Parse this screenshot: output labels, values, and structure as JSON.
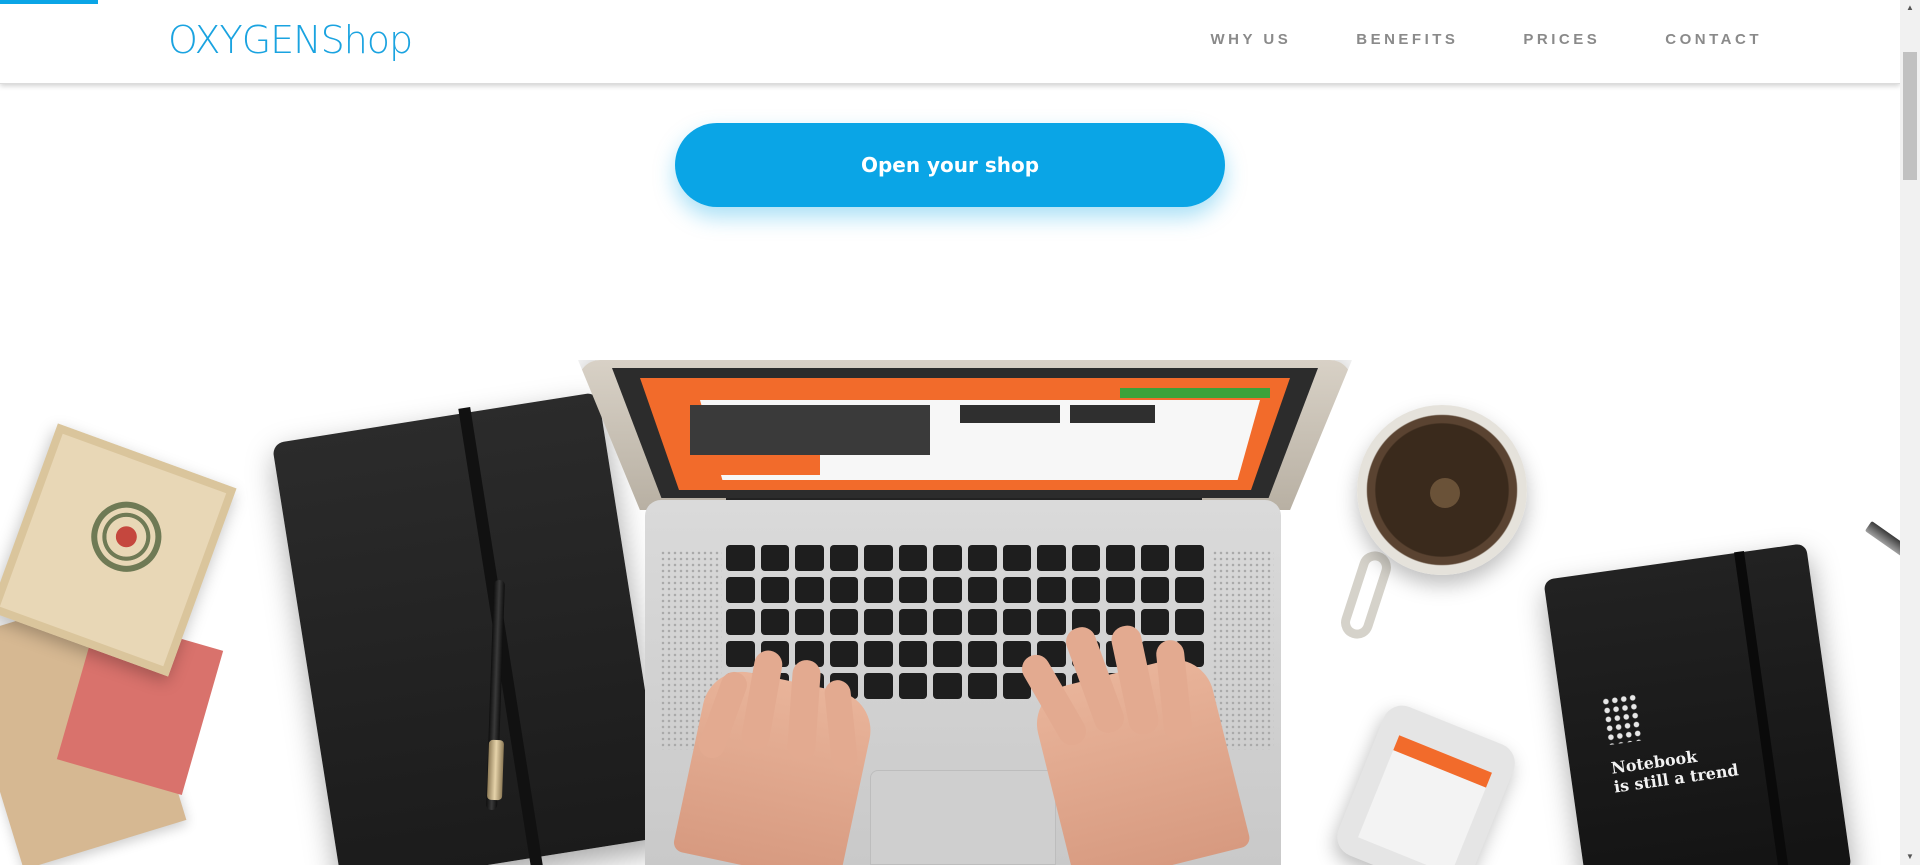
{
  "header": {
    "logo": "OXYGENShop",
    "nav": [
      "WHY US",
      "BENEFITS",
      "PRICES",
      "CONTACT"
    ]
  },
  "hero": {
    "cta_label": "Open your shop",
    "notebook_text": "Notebook\nis still a trend"
  },
  "colors": {
    "accent": "#0aa5e6",
    "nav_text": "#8a8a8a",
    "logo": "#1aa3e0",
    "shop_orange": "#f26b2b"
  },
  "icons": {
    "scroll_up": "scroll-up-arrow-icon",
    "scroll_down": "scroll-down-arrow-icon"
  }
}
